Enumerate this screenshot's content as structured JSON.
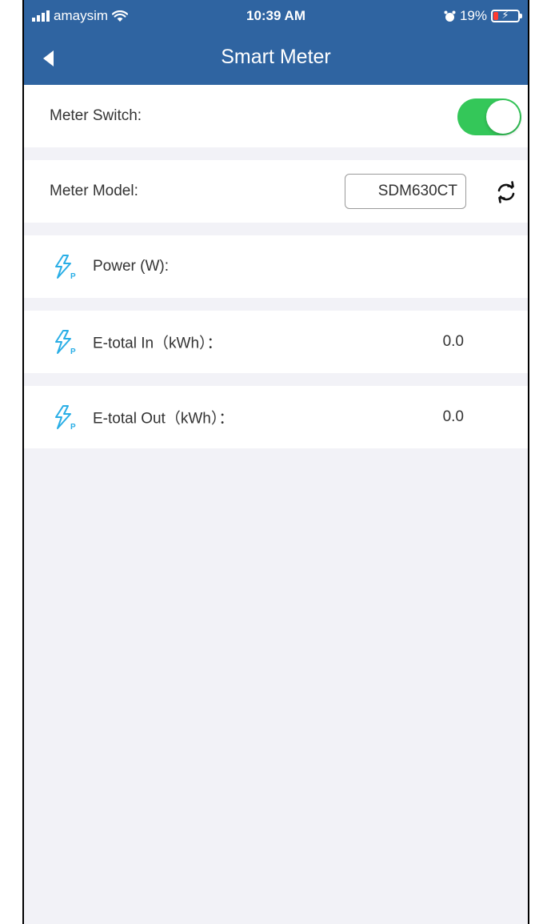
{
  "status_bar": {
    "carrier": "amaysim",
    "time": "10:39 AM",
    "battery_percent": "19%",
    "battery_level": 0.19,
    "battery_color": "#ff3b30"
  },
  "nav": {
    "title": "Smart Meter",
    "back_icon": "back-arrow-icon",
    "background_color": "#2f64a1"
  },
  "meter_switch": {
    "label": "Meter Switch:",
    "on": true,
    "on_color": "#34c759"
  },
  "meter_model": {
    "label": "Meter Model:",
    "value": "SDM630CT",
    "refresh_icon": "refresh-icon"
  },
  "readings": [
    {
      "label": "Power (W):",
      "value": "",
      "icon": "lightning-bolt-icon"
    },
    {
      "label": "E-total In（kWh）：",
      "value": "0.0",
      "icon": "lightning-bolt-icon"
    },
    {
      "label": "E-total Out（kWh）：",
      "value": "0.0",
      "icon": "lightning-bolt-icon"
    }
  ],
  "icon_color": "#29aee6"
}
